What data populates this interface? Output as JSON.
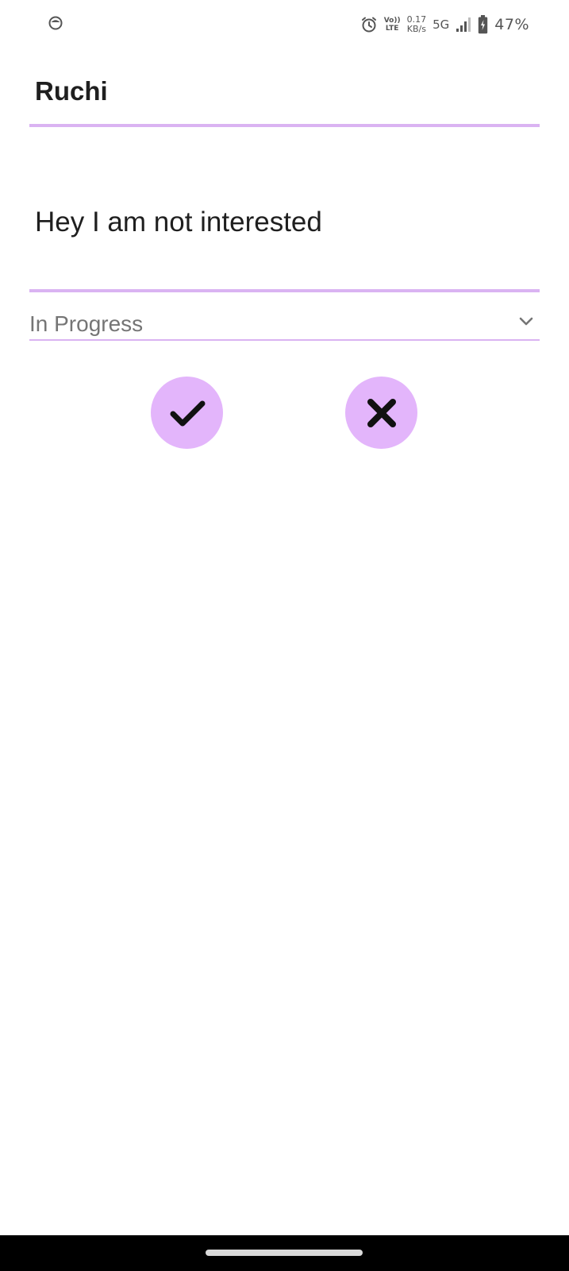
{
  "status_bar": {
    "app_icon": "notification-app-icon",
    "alarm_icon": "alarm-icon",
    "volte_top": "Vo))",
    "volte_bottom": "LTE",
    "speed_value": "0.17",
    "speed_unit": "KB/s",
    "network_type": "5G",
    "signal_icon": "signal-bars-icon",
    "battery_icon": "battery-charging-icon",
    "battery_percent": "47%"
  },
  "form": {
    "name": "Ruchi",
    "message": "Hey I am not interested",
    "status_select": {
      "selected": "In Progress",
      "icon": "chevron-down-icon"
    }
  },
  "actions": {
    "confirm_icon": "check-icon",
    "cancel_icon": "close-icon"
  },
  "colors": {
    "accent": "#dab3f2",
    "button_fill": "#e3b5fb",
    "text_primary": "#1f1f1f",
    "text_secondary": "#757575"
  }
}
